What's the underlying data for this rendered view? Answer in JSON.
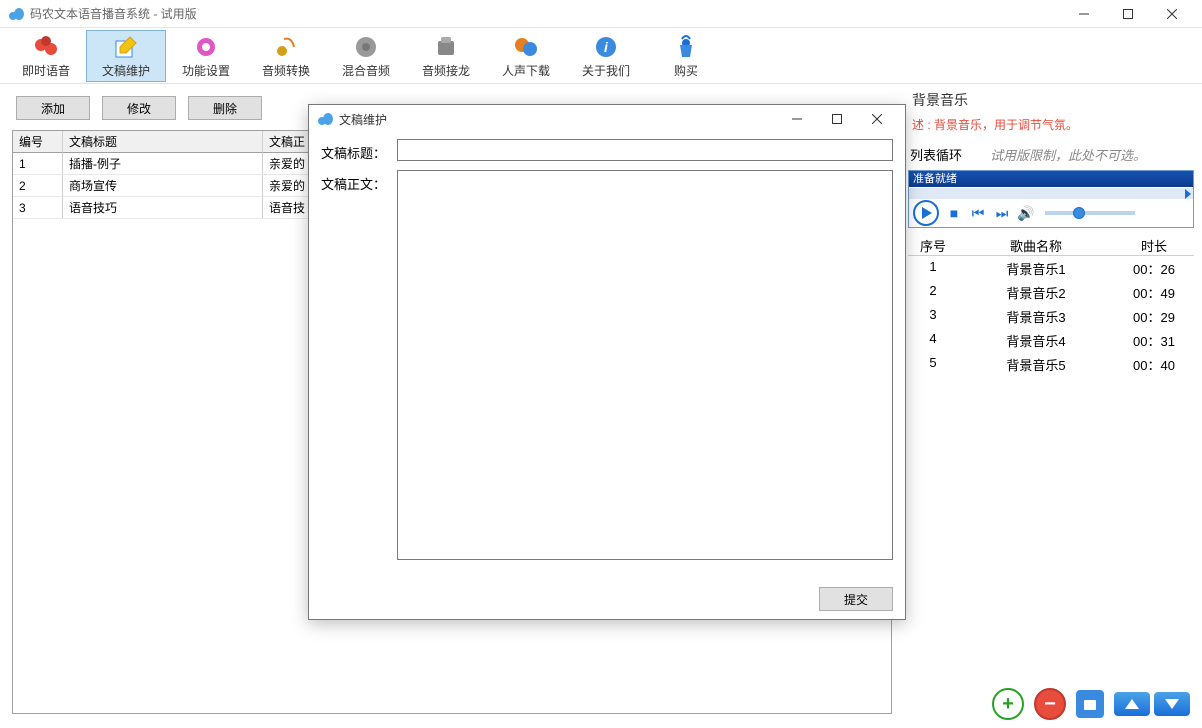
{
  "window": {
    "title": "码农文本语音播音系统 - 试用版"
  },
  "toolbar": [
    {
      "label": "即时语音",
      "icon": "voice-icon"
    },
    {
      "label": "文稿维护",
      "icon": "doc-icon",
      "active": true
    },
    {
      "label": "功能设置",
      "icon": "gear-icon"
    },
    {
      "label": "音频转换",
      "icon": "convert-icon"
    },
    {
      "label": "混合音频",
      "icon": "mix-icon"
    },
    {
      "label": "音频接龙",
      "icon": "chain-icon"
    },
    {
      "label": "人声下载",
      "icon": "download-icon"
    },
    {
      "label": "关于我们",
      "icon": "about-icon"
    },
    {
      "label": "购买",
      "icon": "buy-icon"
    }
  ],
  "buttons": {
    "add": "添加",
    "edit": "修改",
    "delete": "删除"
  },
  "table": {
    "headers": {
      "id": "编号",
      "title": "文稿标题",
      "body": "文稿正"
    },
    "rows": [
      {
        "id": "1",
        "title": "插播-例子",
        "body": "亲爱的"
      },
      {
        "id": "2",
        "title": "商场宣传",
        "body": "亲爱的"
      },
      {
        "id": "3",
        "title": "语音技巧",
        "body": "语音技"
      }
    ]
  },
  "bgm": {
    "title": "背景音乐",
    "desc_prefix": "述 : ",
    "desc": "背景音乐，用于调节气氛。",
    "loop_label": "列表循环",
    "trial_note": "试用版限制，此处不可选。",
    "player_status": "准备就绪",
    "table_headers": {
      "idx": "序号",
      "name": "歌曲名称",
      "dur": "时长"
    },
    "songs": [
      {
        "idx": "1",
        "name": "背景音乐1",
        "dur": "00：26"
      },
      {
        "idx": "2",
        "name": "背景音乐2",
        "dur": "00：49"
      },
      {
        "idx": "3",
        "name": "背景音乐3",
        "dur": "00：29"
      },
      {
        "idx": "4",
        "name": "背景音乐4",
        "dur": "00：31"
      },
      {
        "idx": "5",
        "name": "背景音乐5",
        "dur": "00：40"
      }
    ]
  },
  "dialog": {
    "title": "文稿维护",
    "label_title": "文稿标题：",
    "label_body": "文稿正文：",
    "title_value": "",
    "body_value": "",
    "submit": "提交"
  }
}
